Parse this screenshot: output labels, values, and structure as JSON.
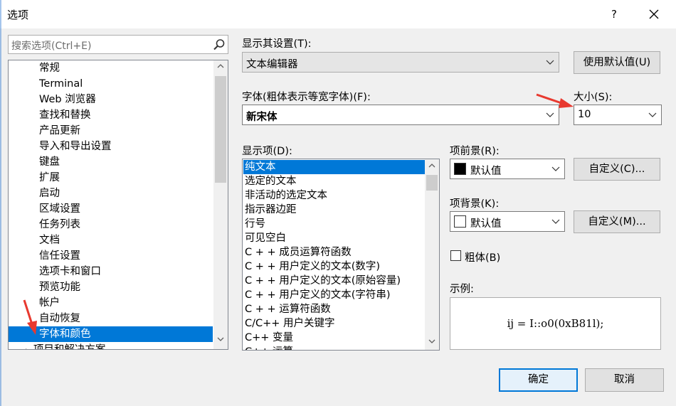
{
  "window": {
    "title": "选项",
    "help_glyph": "?",
    "close_icon": "close-icon"
  },
  "search": {
    "placeholder": "搜索选项(Ctrl+E)",
    "icon": "search-icon"
  },
  "tree": {
    "items": [
      {
        "label": "常规"
      },
      {
        "label": "Terminal"
      },
      {
        "label": "Web 浏览器"
      },
      {
        "label": "查找和替换"
      },
      {
        "label": "产品更新"
      },
      {
        "label": "导入和导出设置"
      },
      {
        "label": "键盘"
      },
      {
        "label": "扩展"
      },
      {
        "label": "启动"
      },
      {
        "label": "区域设置"
      },
      {
        "label": "任务列表"
      },
      {
        "label": "文档"
      },
      {
        "label": "信任设置"
      },
      {
        "label": "选项卡和窗口"
      },
      {
        "label": "预览功能"
      },
      {
        "label": "帐户"
      },
      {
        "label": "自动恢复"
      },
      {
        "label": "字体和颜色",
        "selected": true
      },
      {
        "label": "项目和解决方案"
      }
    ],
    "collapsed_glyph": "▷"
  },
  "settings": {
    "show_settings_label": "显示其设置(T):",
    "show_settings_value": "文本编辑器",
    "use_defaults_button": "使用默认值(U)",
    "font_label": "字体(粗体表示等宽字体)(F):",
    "font_value": "新宋体",
    "size_label": "大小(S):",
    "size_value": "10",
    "display_items_label": "显示项(D):",
    "display_items": [
      {
        "label": "纯文本",
        "selected": true
      },
      {
        "label": "选定的文本"
      },
      {
        "label": "非活动的选定文本"
      },
      {
        "label": "指示器边距"
      },
      {
        "label": "行号"
      },
      {
        "label": "可见空白"
      },
      {
        "label": "C + + 成员运算符函数"
      },
      {
        "label": "C + + 用户定义的文本(数字)"
      },
      {
        "label": "C + + 用户定义的文本(原始容量)"
      },
      {
        "label": "C + + 用户定义的文本(字符串)"
      },
      {
        "label": "C + + 运算符函数"
      },
      {
        "label": "C/C++ 用户关键字"
      },
      {
        "label": "C++ 变量"
      },
      {
        "label": "C++ 运算"
      }
    ],
    "foreground_label": "项前景(R):",
    "foreground_value": "默认值",
    "foreground_color": "#000000",
    "foreground_custom_button": "自定义(C)...",
    "background_label": "项背景(K):",
    "background_value": "默认值",
    "background_color": "#ffffff",
    "background_custom_button": "自定义(M)...",
    "bold_label": "粗体(B)",
    "bold_checked": false,
    "sample_label": "示例:",
    "sample_text": "ij = I::o0(0xB81l);"
  },
  "footer": {
    "ok_button": "确定",
    "cancel_button": "取消"
  },
  "colors": {
    "accent": "#0078d7",
    "annotation_arrow": "#e8392f"
  }
}
